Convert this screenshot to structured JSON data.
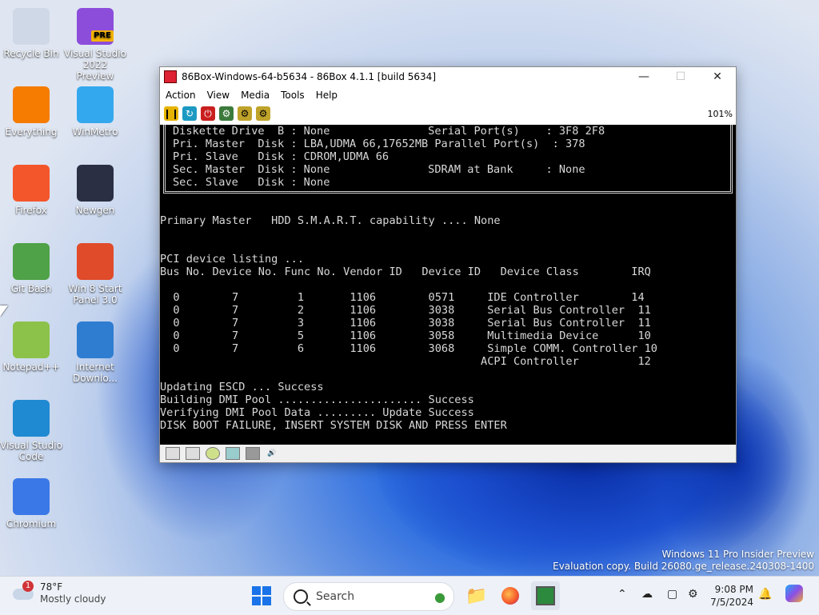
{
  "desktop": {
    "icons": [
      {
        "label": "Recycle Bin",
        "icon": "recycle-bin-icon",
        "color": "#cfd8e6"
      },
      {
        "label": "Visual Studio 2022 Preview",
        "icon": "visual-studio-icon",
        "color": "#8d4ddb",
        "badge": "PRE"
      },
      {
        "label": "Everything",
        "icon": "magnifier-icon",
        "color": "#f57c00"
      },
      {
        "label": "WinMetro",
        "icon": "windows-icon",
        "color": "#34a8ee"
      },
      {
        "label": "Firefox",
        "icon": "firefox-icon",
        "color": "#f4562b"
      },
      {
        "label": "Newgen",
        "icon": "monitor-icon",
        "color": "#2a2f44"
      },
      {
        "label": "Git Bash",
        "icon": "git-bash-icon",
        "color": "#4fa247"
      },
      {
        "label": "Win 8 Start Panel 3.0",
        "icon": "windows-flag-icon",
        "color": "#e04b2a"
      },
      {
        "label": "Notepad++",
        "icon": "notepad-plus-plus-icon",
        "color": "#8cc24a"
      },
      {
        "label": "Internet Downlo...",
        "icon": "internet-download-manager-icon",
        "color": "#2e7dd1"
      },
      {
        "label": "Visual Studio Code",
        "icon": "vscode-icon",
        "color": "#1f8ad2"
      },
      {
        "label": "Chromium",
        "icon": "chromium-icon",
        "color": "#3b78e7"
      }
    ]
  },
  "window": {
    "title": "86Box-Windows-64-b5634 - 86Box 4.1.1 [build 5634]",
    "menu": [
      "Action",
      "View",
      "Media",
      "Tools",
      "Help"
    ],
    "zoom": "101%",
    "toolbar_icons": [
      "pause-icon",
      "reset-icon",
      "power-icon",
      "settings-icon",
      "settings-alt-icon",
      "hardware-icon"
    ],
    "statusbar_icons": [
      "floppy-a-icon",
      "floppy-b-icon",
      "cdrom-icon",
      "hdd-icon",
      "network-icon",
      "sound-icon"
    ]
  },
  "bios": {
    "box_lines": [
      "Diskette Drive  B : None               Serial Port(s)    : 3F8 2F8",
      "Pri. Master  Disk : LBA,UDMA 66,17652MB Parallel Port(s)  : 378",
      "Pri. Slave   Disk : CDROM,UDMA 66",
      "Sec. Master  Disk : None               SDRAM at Bank     : None",
      "Sec. Slave   Disk : None"
    ],
    "smart_line": "Primary Master   HDD S.M.A.R.T. capability .... None",
    "pci_title": "PCI device listing ...",
    "pci_header": "Bus No. Device No. Func No. Vendor ID   Device ID   Device Class        IRQ",
    "pci_rows": [
      "  0        7         1       1106        0571     IDE Controller        14",
      "  0        7         2       1106        3038     Serial Bus Controller  11",
      "  0        7         3       1106        3038     Serial Bus Controller  11",
      "  0        7         5       1106        3058     Multimedia Device      10",
      "  0        7         6       1106        3068     Simple COMM. Controller 10",
      "                                                 ACPI Controller         12"
    ],
    "status_lines": [
      "Updating ESCD ... Success",
      "Building DMI Pool ...................... Success",
      "Verifying DMI Pool Data ......... Update Success",
      "DISK BOOT FAILURE, INSERT SYSTEM DISK AND PRESS ENTER"
    ]
  },
  "watermark": {
    "line1": "Windows 11 Pro Insider Preview",
    "line2": "Evaluation copy. Build 26080.ge_release.240308-1400"
  },
  "taskbar": {
    "weather_temp": "78°F",
    "weather_desc": "Mostly cloudy",
    "weather_badge": "1",
    "search_placeholder": "Search",
    "time": "9:08 PM",
    "date": "7/5/2024"
  }
}
